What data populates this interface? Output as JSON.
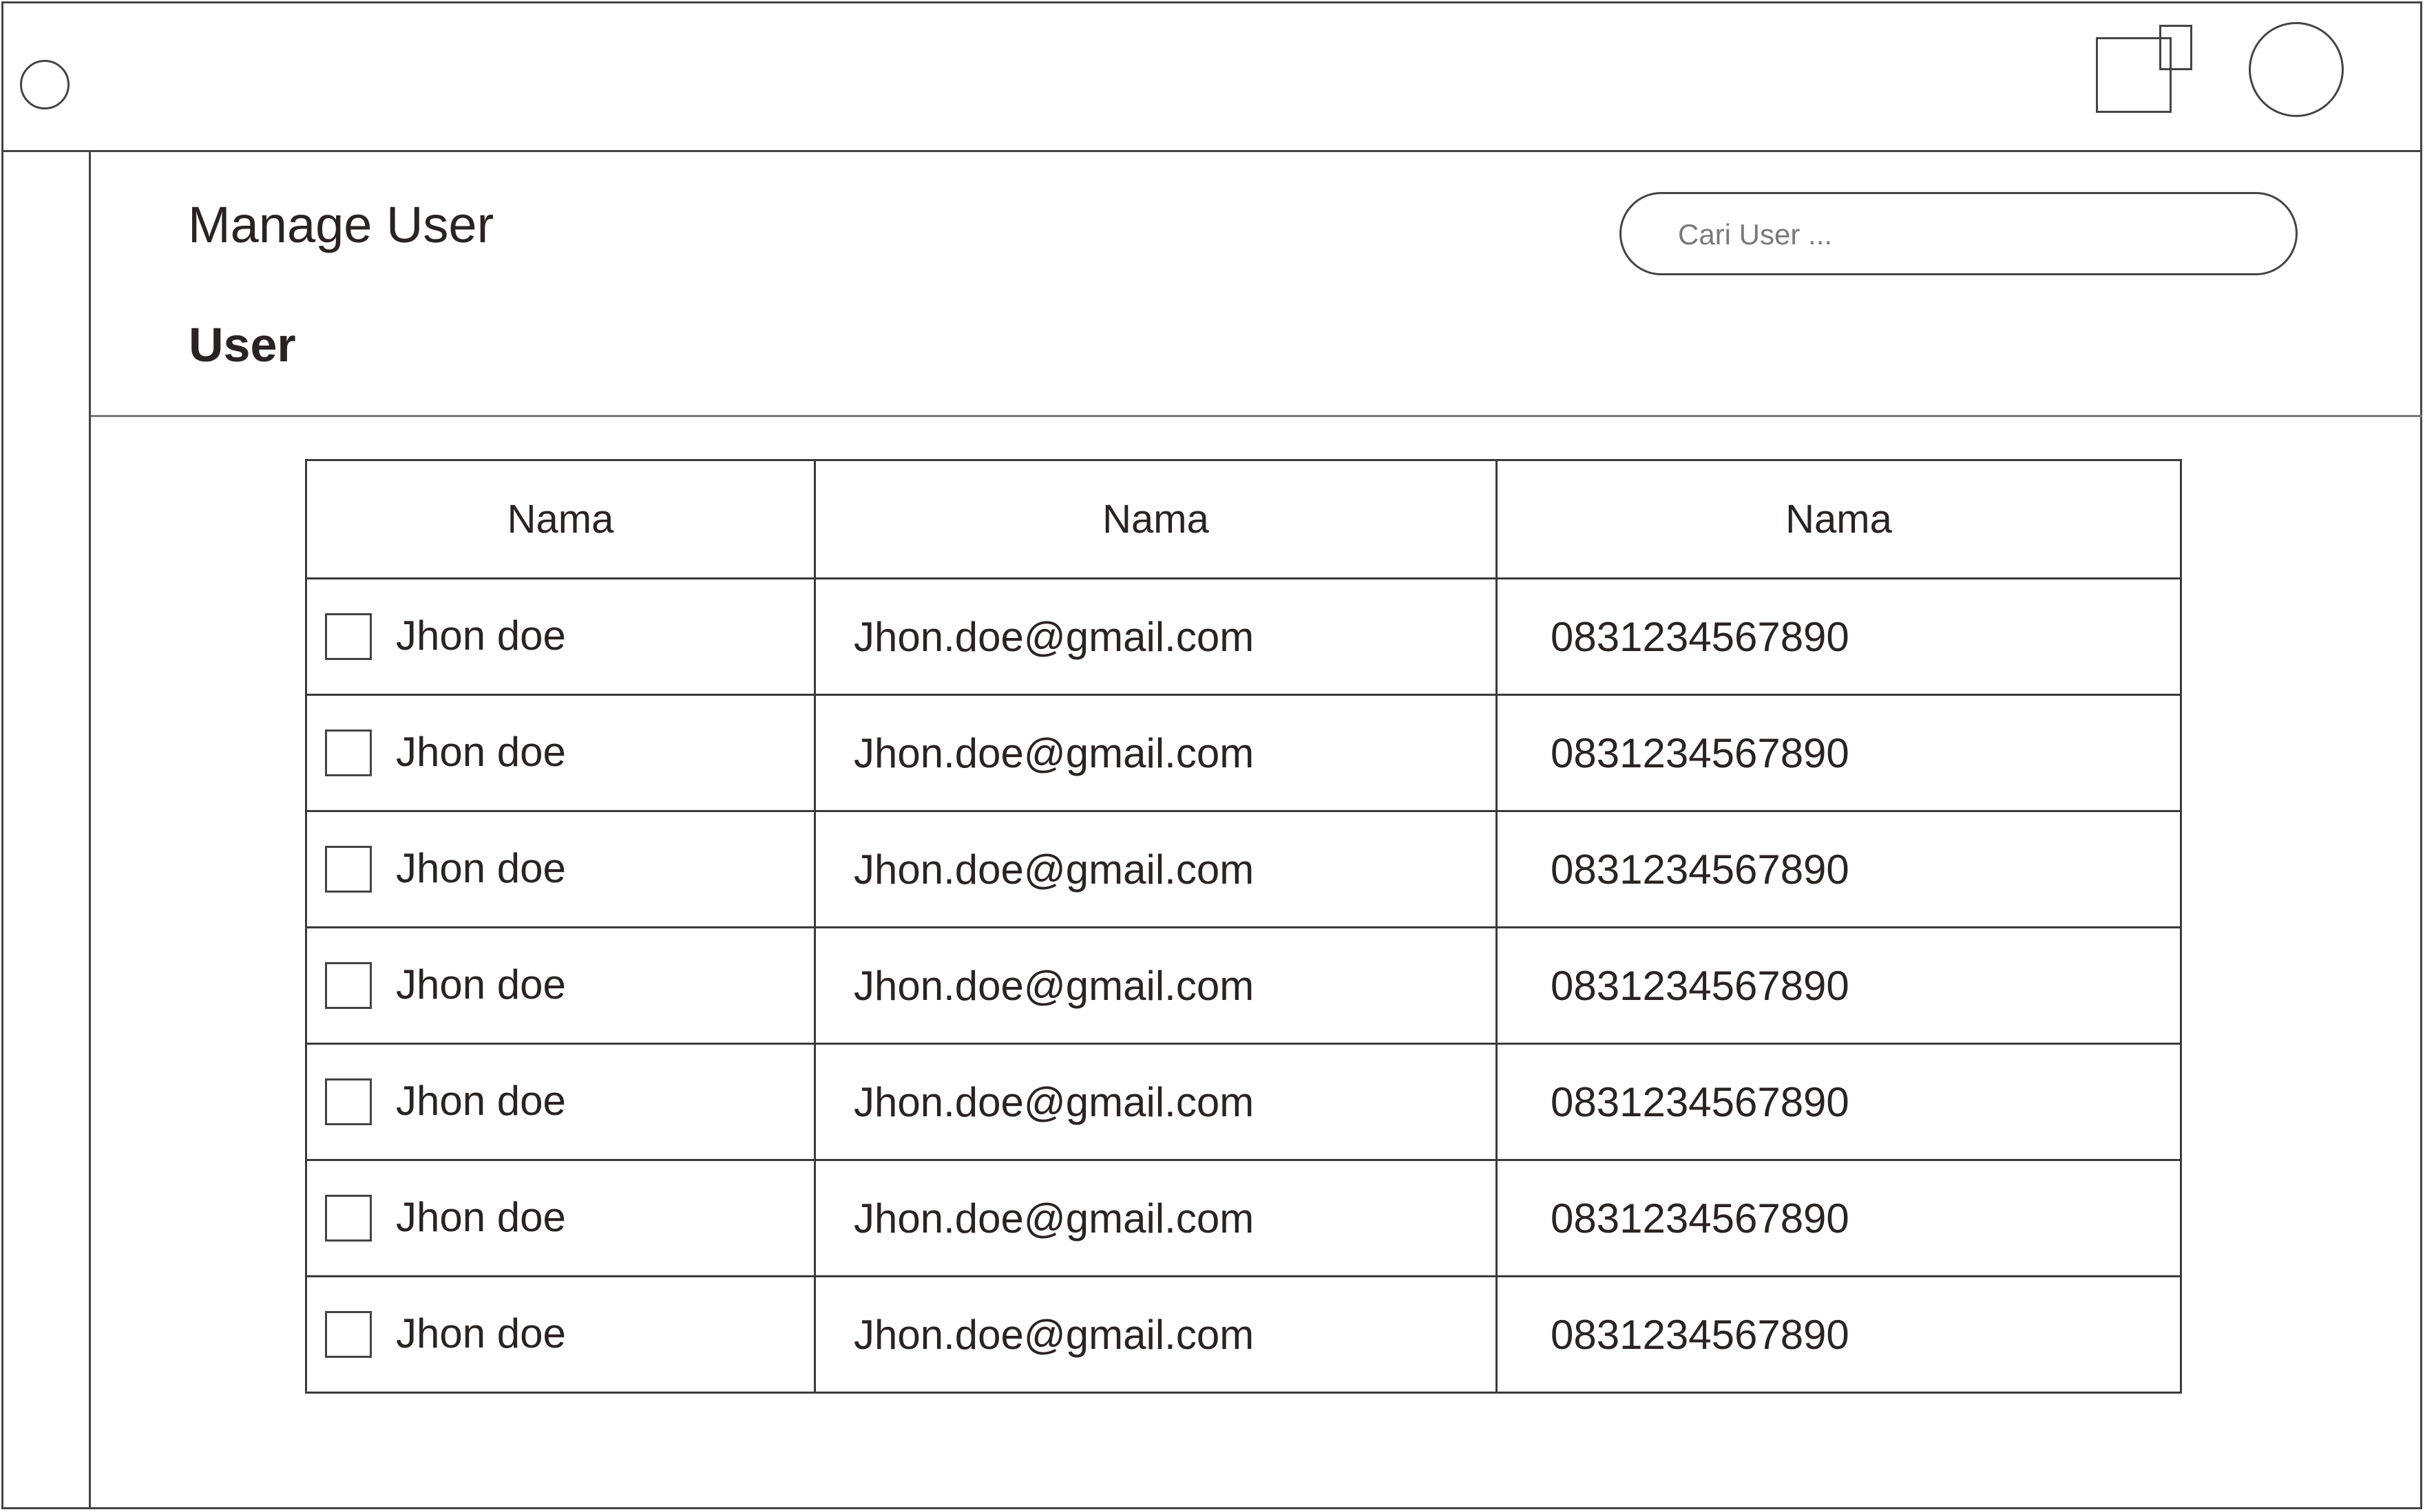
{
  "header": {
    "menu_icon": "menu-circle-icon",
    "notification_icon": "overlap-squares-icon",
    "avatar_icon": "avatar-circle-icon"
  },
  "page": {
    "title": "Manage User",
    "section": "User"
  },
  "search": {
    "placeholder": "Cari User ..."
  },
  "table": {
    "columns": [
      "Nama",
      "Nama",
      "Nama"
    ],
    "rows": [
      {
        "name": "Jhon doe",
        "email": "Jhon.doe@gmail.com",
        "phone": "0831234567890"
      },
      {
        "name": "Jhon doe",
        "email": "Jhon.doe@gmail.com",
        "phone": "0831234567890"
      },
      {
        "name": "Jhon doe",
        "email": "Jhon.doe@gmail.com",
        "phone": "0831234567890"
      },
      {
        "name": "Jhon doe",
        "email": "Jhon.doe@gmail.com",
        "phone": "0831234567890"
      },
      {
        "name": "Jhon doe",
        "email": "Jhon.doe@gmail.com",
        "phone": "0831234567890"
      },
      {
        "name": "Jhon doe",
        "email": "Jhon.doe@gmail.com",
        "phone": "0831234567890"
      },
      {
        "name": "Jhon doe",
        "email": "Jhon.doe@gmail.com",
        "phone": "0831234567890"
      }
    ]
  }
}
